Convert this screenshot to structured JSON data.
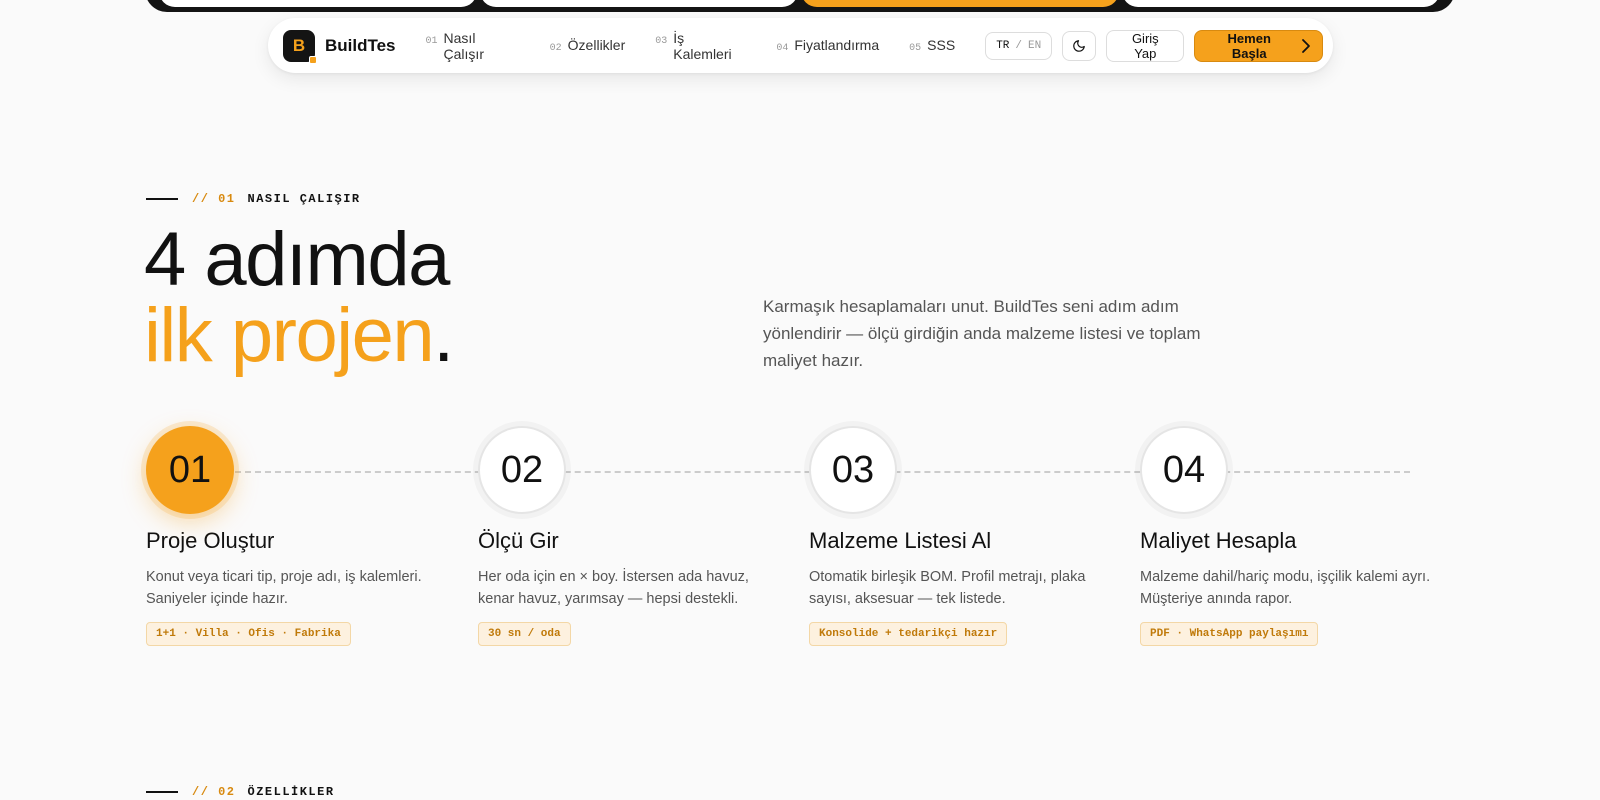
{
  "brand": {
    "logo_letter": "B",
    "name": "BuildTes",
    "accent": "#f5a11c"
  },
  "nav": {
    "links": [
      {
        "num": "01",
        "label": "Nasıl Çalışır"
      },
      {
        "num": "02",
        "label": "Özellikler"
      },
      {
        "num": "03",
        "label": "İş Kalemleri"
      },
      {
        "num": "04",
        "label": "Fiyatlandırma"
      },
      {
        "num": "05",
        "label": "SSS"
      }
    ],
    "lang_active": "TR",
    "lang_sep": "/",
    "lang_other": "EN",
    "theme_icon": "moon-icon",
    "login_label": "Giriş Yap",
    "start_label": "Hemen Başla",
    "start_icon": "chevron-right-icon"
  },
  "section1": {
    "code": "// 01",
    "name": "NASIL ÇALIŞIR",
    "headline_line1": "4 adımda",
    "headline_line2": "ilk projen",
    "headline_period": ".",
    "lead": "Karmaşık hesaplamaları unut. BuildTes seni adım adım yönlendirir — ölçü girdiğin anda malzeme listesi ve toplam maliyet hazır."
  },
  "steps": [
    {
      "num": "01",
      "title": "Proje Oluştur",
      "desc": "Konut veya ticari tip, proje adı, iş kalemleri. Saniyeler içinde hazır.",
      "tag": "1+1 · Villa · Ofis · Fabrika"
    },
    {
      "num": "02",
      "title": "Ölçü Gir",
      "desc": "Her oda için en × boy. İstersen ada havuz, kenar havuz, yarımsay — hepsi destekli.",
      "tag": "30 sn / oda"
    },
    {
      "num": "03",
      "title": "Malzeme Listesi Al",
      "desc": "Otomatik birleşik BOM. Profil metrajı, plaka sayısı, aksesuar — tek listede.",
      "tag": "Konsolide + tedarikçi hazır"
    },
    {
      "num": "04",
      "title": "Maliyet Hesapla",
      "desc": "Malzeme dahil/hariç modu, işçilik kalemi ayrı. Müşteriye anında rapor.",
      "tag": "PDF · WhatsApp paylaşımı"
    }
  ],
  "section2": {
    "code": "// 02",
    "name": "ÖZELLİKLER"
  }
}
